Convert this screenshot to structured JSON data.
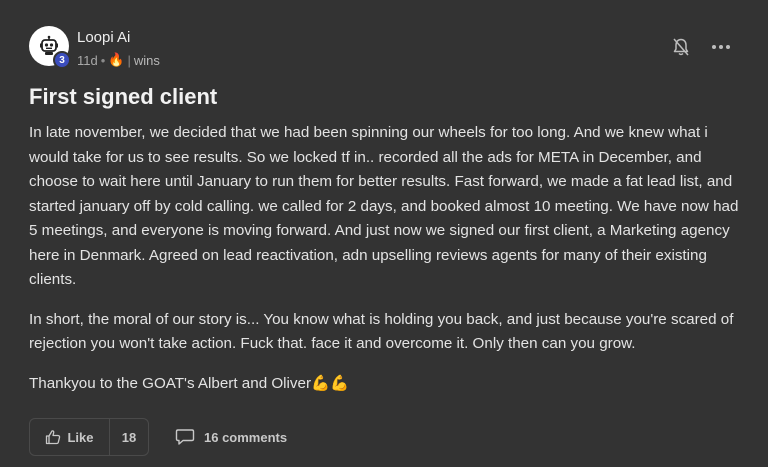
{
  "post": {
    "author": "Loopi Ai",
    "level": "3",
    "time": "11d",
    "separator": "•",
    "emoji": "🔥",
    "category_sep": "|",
    "category": "wins",
    "title": "First signed client",
    "paragraphs": [
      "In late november, we decided that we had been spinning our wheels for too long. And we knew what i would take for us to see results. So we locked tf in.. recorded all the ads for META in December, and choose to wait here until January to run them for better results. Fast forward, we made a fat lead list, and started january off by cold calling. we called for 2 days, and booked almost 10 meeting. We have now had 5 meetings, and everyone is moving forward. And just now we signed our first client, a Marketing agency here in Denmark. Agreed on lead reactivation, adn upselling reviews agents for many of their existing clients.",
      "In short, the moral of our story is... You know what is holding you back, and just because you're scared of rejection you won't take action. Fuck that. face it and overcome it. Only then can you grow.",
      "Thankyou to the GOAT's Albert and Oliver💪💪"
    ],
    "like_label": "Like",
    "like_count": "18",
    "comments_label": "16 comments"
  },
  "colors": {
    "background": "#333333",
    "badge": "#3b4dbd",
    "text": "#e3e3e3",
    "muted": "#a9a9a9"
  },
  "icons": {
    "avatar": "robot-icon",
    "bell": "bell-off-icon",
    "more": "more-horizontal-icon",
    "like": "thumbs-up-icon",
    "comment": "comment-icon"
  }
}
